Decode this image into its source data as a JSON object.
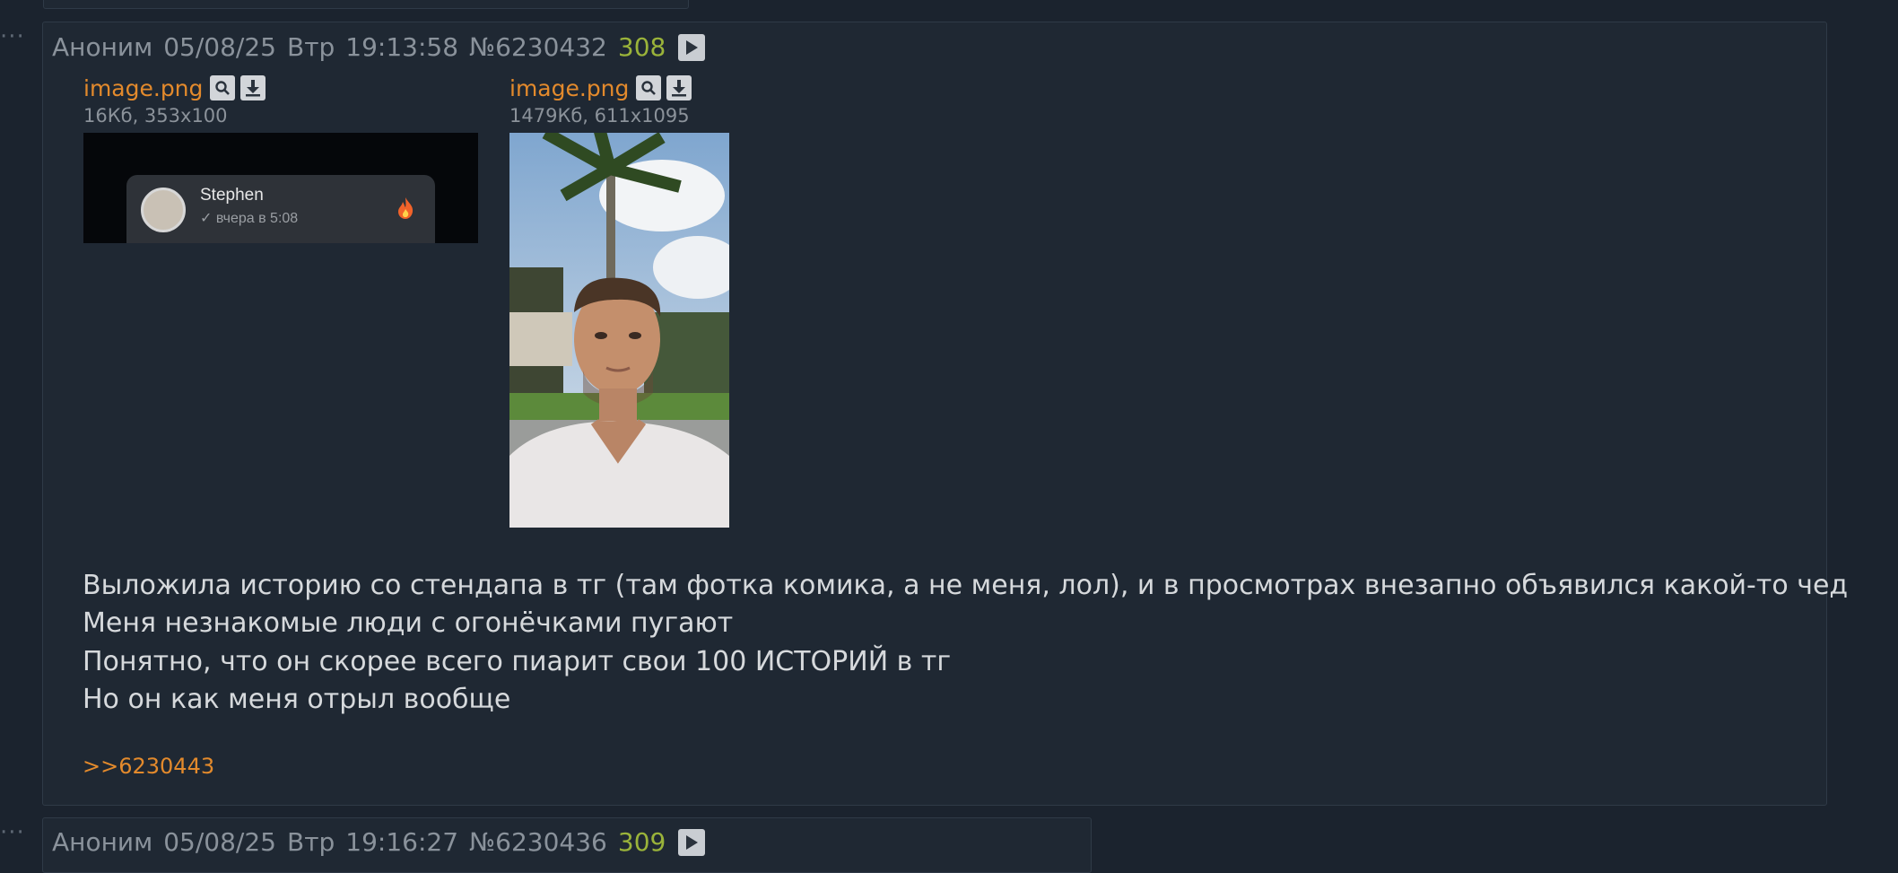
{
  "posts": [
    {
      "author": "Аноним",
      "date": "05/08/25",
      "weekday": "Втр",
      "time": "19:13:58",
      "number": "№6230432",
      "reply_count": "308",
      "files": [
        {
          "name": "image.png",
          "meta": "16Кб, 353x100",
          "thumb_caption_name": "Stephen",
          "thumb_caption_time": "✓ вчера в 5:08"
        },
        {
          "name": "image.png",
          "meta": "1479Кб, 611x1095"
        }
      ],
      "message_lines": [
        "Выложила историю со стендапа в тг (там фотка комика, а не меня, лол), и в просмотрах внезапно объявился какой-то чед",
        "Меня незнакомые люди с огонёчками пугают",
        "Понятно, что он скорее всего пиарит свои 100 ИСТОРИЙ в тг",
        "Но он как меня отрыл вообще"
      ],
      "replies": [
        ">>6230443"
      ]
    },
    {
      "author": "Аноним",
      "date": "05/08/25",
      "weekday": "Втр",
      "time": "19:16:27",
      "number": "№6230436",
      "reply_count": "309"
    }
  ],
  "colors": {
    "background": "#1b232e",
    "post_background": "#1f2833",
    "link": "#e38a2c",
    "reply_count": "#9ab33a"
  }
}
